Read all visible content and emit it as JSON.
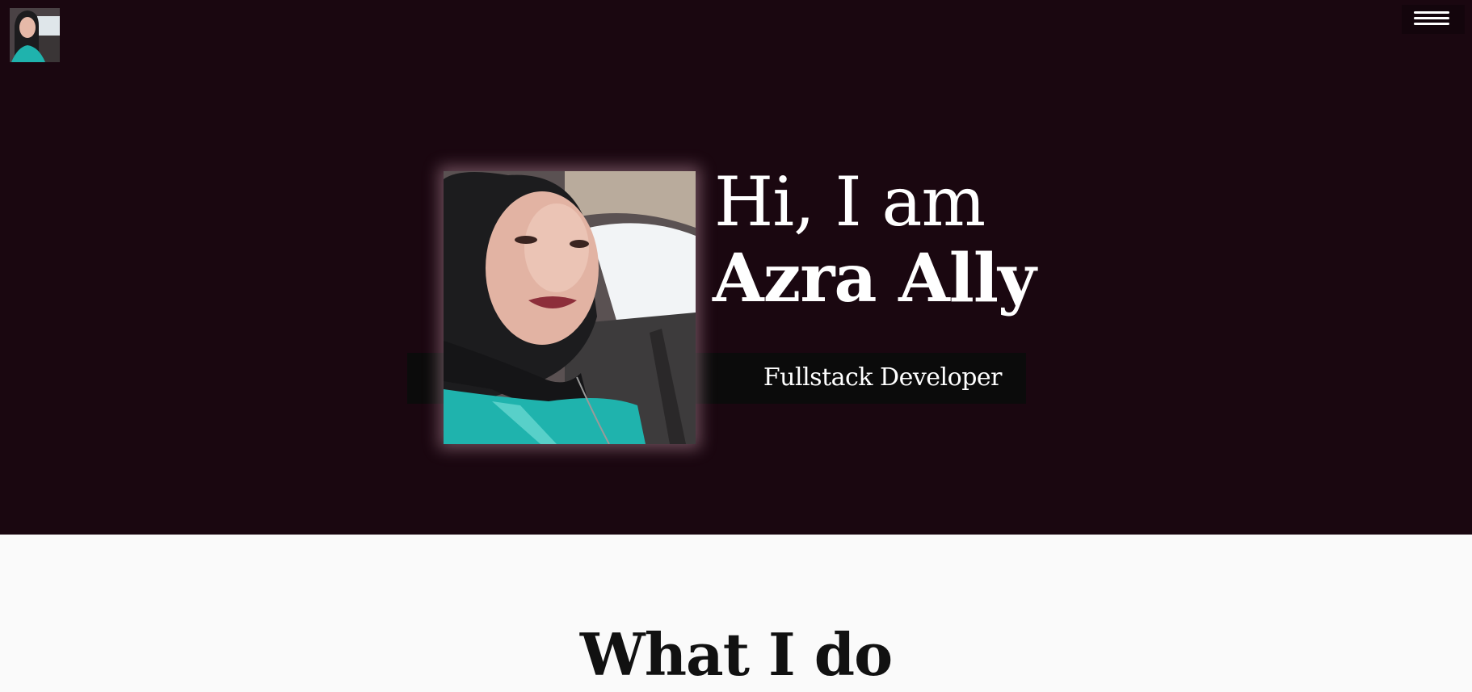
{
  "header": {
    "avatar_icon": "profile-photo-thumbnail",
    "menu_icon": "hamburger-menu-icon"
  },
  "hero": {
    "greeting": "Hi, I am",
    "name": "Azra Ally",
    "role": "Fullstack Developer",
    "portrait_icon": "profile-photo"
  },
  "section": {
    "title": "What I do"
  },
  "colors": {
    "hero_background": "#1a0710",
    "role_band": "#0b0b0b",
    "section_background": "#fafafa",
    "text_light": "#ffffff",
    "text_dark": "#111111"
  }
}
